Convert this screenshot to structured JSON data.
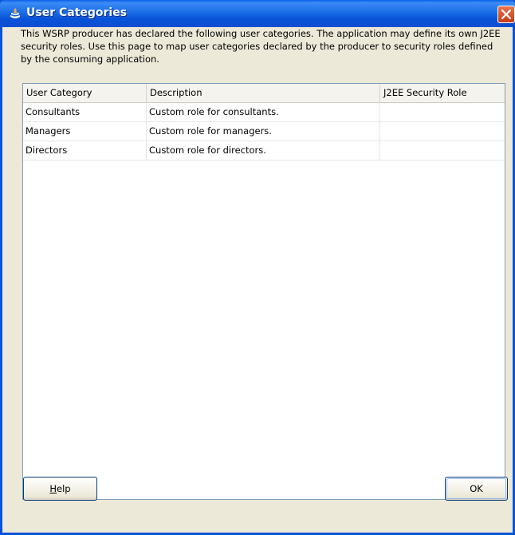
{
  "window": {
    "title": "User Categories",
    "icon": "oracle-jdeveloper-icon",
    "close_icon": "close-icon"
  },
  "intro_text": "This WSRP producer has declared the following user categories. The application may define its own J2EE security roles. Use this page to map user categories declared by the producer to security roles defined by the consuming application.",
  "table": {
    "columns": [
      "User Category",
      "Description",
      "J2EE Security Role"
    ],
    "rows": [
      {
        "category": "Consultants",
        "description": "Custom role for consultants.",
        "role": ""
      },
      {
        "category": "Managers",
        "description": "Custom role for managers.",
        "role": ""
      },
      {
        "category": "Directors",
        "description": "Custom role for directors.",
        "role": ""
      }
    ]
  },
  "buttons": {
    "help_mnemonic": "H",
    "help_rest": "elp",
    "ok": "OK"
  },
  "colors": {
    "titlebar": "#0a52d8",
    "dialog_bg": "#ece9d8",
    "close_button": "#c83a18"
  }
}
